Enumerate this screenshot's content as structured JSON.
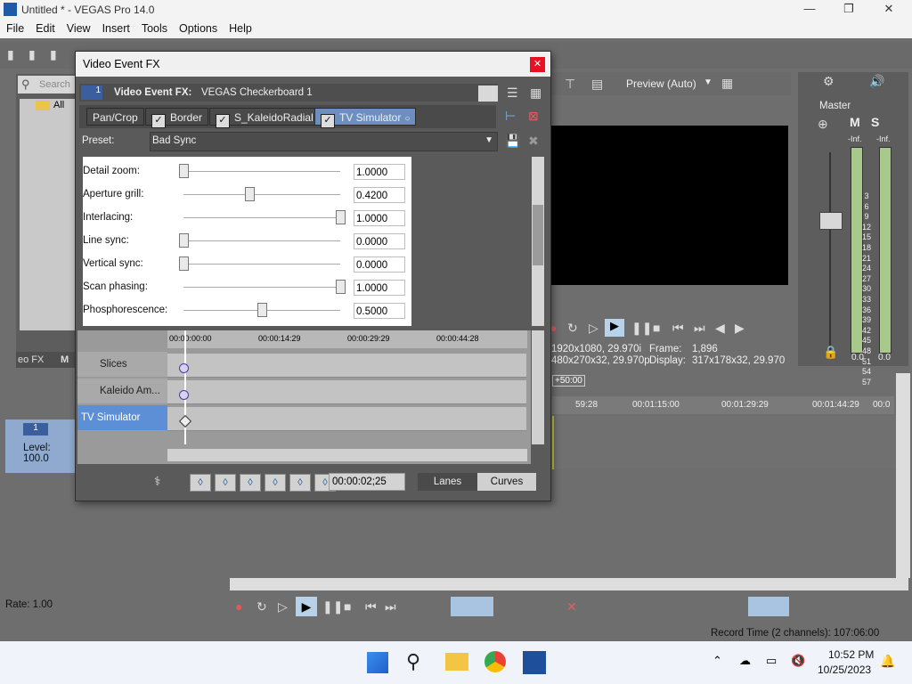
{
  "window": {
    "title": "Untitled * - VEGAS Pro 14.0",
    "menu": [
      "File",
      "Edit",
      "View",
      "Insert",
      "Tools",
      "Options",
      "Help"
    ]
  },
  "dialog": {
    "title": "Video Event FX",
    "event_index": "1",
    "event_fx_label": "Video Event FX:",
    "event_fx_name": "VEGAS Checkerboard 1",
    "fx_chain": [
      {
        "label": "Pan/Crop",
        "checked": false
      },
      {
        "label": "Border",
        "checked": true
      },
      {
        "label": "S_KaleidoRadial",
        "checked": true
      },
      {
        "label": "TV Simulator",
        "checked": true,
        "selected": true
      }
    ],
    "preset_label": "Preset:",
    "preset_value": "Bad Sync",
    "params": [
      {
        "label": "Detail zoom:",
        "value": "1.0000",
        "level": 0.0
      },
      {
        "label": "Aperture grill:",
        "value": "0.4200",
        "level": 0.42
      },
      {
        "label": "Interlacing:",
        "value": "1.0000",
        "level": 1.0
      },
      {
        "label": "Line sync:",
        "value": "0.0000",
        "level": 0.0
      },
      {
        "label": "Vertical sync:",
        "value": "0.0000",
        "level": 0.0
      },
      {
        "label": "Scan phasing:",
        "value": "1.0000",
        "level": 1.0
      },
      {
        "label": "Phosphorescence:",
        "value": "0.5000",
        "level": 0.5
      }
    ],
    "timeline_marks": [
      "00:00:00:00",
      "00:00:14:29",
      "00:00:29:29",
      "00:00:44:28"
    ],
    "lanes": [
      "Slices",
      "Kaleido Am...",
      "TV Simulator"
    ],
    "time_value": "00:00:02;25",
    "lanes_button": "Lanes",
    "curves_button": "Curves"
  },
  "explorer": {
    "search_placeholder": "Search",
    "tree_root": "All",
    "tab_label": "eo FX",
    "tab2_label": "M"
  },
  "preview": {
    "quality": "Preview (Auto)",
    "project": "1920x1080, 29.970i",
    "preview_res": "480x270x32, 29.970p",
    "frame_label": "Frame:",
    "frame_value": "1,896",
    "display_label": "Display:",
    "display_value": "317x178x32, 29.970"
  },
  "mixer": {
    "title": "Master",
    "inf_left": "-Inf.",
    "inf_right": "-Inf.",
    "scale": [
      "3",
      "6",
      "9",
      "12",
      "15",
      "18",
      "21",
      "24",
      "27",
      "30",
      "33",
      "36",
      "39",
      "42",
      "45",
      "48",
      "51",
      "54",
      "57"
    ],
    "bottom_left": "0.0",
    "bottom_right": "0.0"
  },
  "track": {
    "number": "1",
    "level_label": "Level: 100.0"
  },
  "timeline": {
    "offset": "+50:00",
    "marks": [
      "59:28",
      "00:01:15:00",
      "00:01:29:29",
      "00:01:44:29",
      "00:0"
    ]
  },
  "status": {
    "rate": "Rate: 1.00",
    "record_time": "Record Time (2 channels): 107:06:00"
  },
  "taskbar": {
    "time": "10:52 PM",
    "date": "10/25/2023"
  }
}
